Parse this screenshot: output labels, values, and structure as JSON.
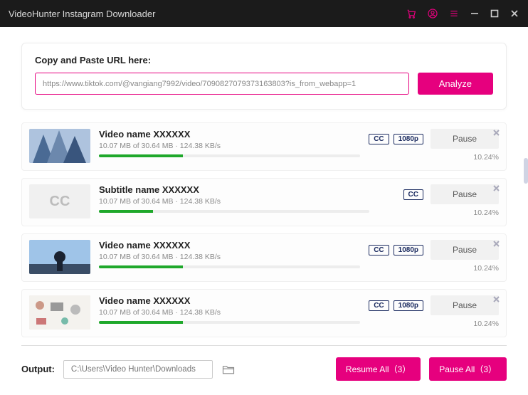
{
  "titlebar": {
    "title": "VideoHunter Instagram Downloader"
  },
  "url_section": {
    "label": "Copy and Paste URL here:",
    "value": "https://www.tiktok.com/@vangiang7992/video/7090827079373163803?is_from_webapp=1",
    "analyze_label": "Analyze"
  },
  "downloads": [
    {
      "title": "Video name XXXXXX",
      "stats": "10.07 MB of 30.64 MB · 124.38 KB/s",
      "badges": [
        "CC",
        "1080p"
      ],
      "action": "Pause",
      "percent_label": "10.24%",
      "progress": 32,
      "thumb": "city"
    },
    {
      "title": "Subtitle name XXXXXX",
      "stats": "10.07 MB of 30.64 MB · 124.38 KB/s",
      "badges": [
        "CC"
      ],
      "action": "Pause",
      "percent_label": "10.24%",
      "progress": 20,
      "thumb": "cc"
    },
    {
      "title": "Video name XXXXXX",
      "stats": "10.07 MB of 30.64 MB · 124.38 KB/s",
      "badges": [
        "CC",
        "1080p"
      ],
      "action": "Pause",
      "percent_label": "10.24%",
      "progress": 32,
      "thumb": "silhouette"
    },
    {
      "title": "Video name XXXXXX",
      "stats": "10.07 MB of 30.64 MB · 124.38 KB/s",
      "badges": [
        "CC",
        "1080p"
      ],
      "action": "Pause",
      "percent_label": "10.24%",
      "progress": 32,
      "thumb": "desk"
    }
  ],
  "footer": {
    "output_label": "Output:",
    "output_path": "C:\\Users\\Video Hunter\\Downloads",
    "resume_all": "Resume All（3）",
    "pause_all": "Pause All（3）"
  }
}
